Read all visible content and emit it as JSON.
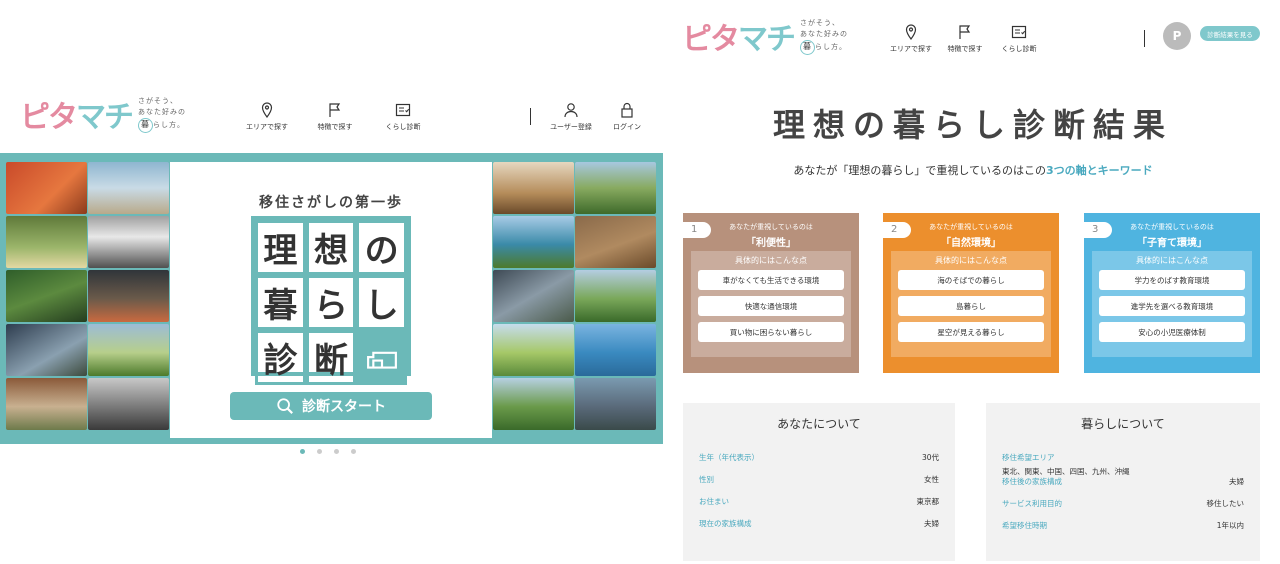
{
  "logo": {
    "text_a": "ピタ",
    "text_b": "マチ",
    "tagline_1": "さがそう、",
    "tagline_2": "あなた好みの",
    "tagline_3a": "暮",
    "tagline_3b": "らし方。"
  },
  "left_nav": [
    {
      "label": "エリアで探す",
      "icon": "map-pin-icon"
    },
    {
      "label": "特徴で探す",
      "icon": "flag-icon"
    },
    {
      "label": "くらし診断",
      "icon": "checklist-icon"
    }
  ],
  "user_nav": [
    {
      "label": "ユーザー登録",
      "icon": "user-icon"
    },
    {
      "label": "ログイン",
      "icon": "lock-icon"
    }
  ],
  "banner": {
    "subtitle": "移住さがしの第一歩",
    "grid": [
      "理",
      "想",
      "の",
      "暮",
      "ら",
      "し",
      "診",
      "断"
    ],
    "start_label": "診断スタート"
  },
  "carousel": {
    "count": 4,
    "active": 1
  },
  "right_nav": [
    {
      "label": "エリアで探す",
      "icon": "map-pin-icon"
    },
    {
      "label": "特徴で探す",
      "icon": "flag-icon"
    },
    {
      "label": "くらし診断",
      "icon": "checklist-icon"
    }
  ],
  "result_button": "診断結果を見る",
  "avatar_letter": "P",
  "result": {
    "title": "理想の暮らし診断結果",
    "desc_a": "あなたが「理想の暮らし」で重視しているのはこの",
    "desc_b": "3つの軸とキーワード"
  },
  "cards": [
    {
      "num": "1",
      "head": "あなたが重視しているのは",
      "key": "「利便性」",
      "label": "具体的にはこんな点",
      "items": [
        "車がなくても生活できる環境",
        "快適な通信環境",
        "買い物に困らない暮らし"
      ],
      "color": "#b7917c"
    },
    {
      "num": "2",
      "head": "あなたが重視しているのは",
      "key": "「自然環境」",
      "label": "具体的にはこんな点",
      "items": [
        "海のそばでの暮らし",
        "島暮らし",
        "星空が見える暮らし"
      ],
      "color": "#ec8f2d"
    },
    {
      "num": "3",
      "head": "あなたが重視しているのは",
      "key": "「子育て環境」",
      "label": "具体的にはこんな点",
      "items": [
        "学力をのばす教育環境",
        "進学先を選べる教育環境",
        "安心の小児医療体制"
      ],
      "color": "#4fb4e0"
    }
  ],
  "about_you": {
    "title": "あなたについて",
    "rows": [
      {
        "k": "生年（年代表示）",
        "v": "30代"
      },
      {
        "k": "性別",
        "v": "女性"
      },
      {
        "k": "お住まい",
        "v": "東京都"
      },
      {
        "k": "現在の家族構成",
        "v": "夫婦"
      }
    ]
  },
  "about_life": {
    "title": "暮らしについて",
    "area_label": "移住希望エリア",
    "area_value": "東北、関東、中国、四国、九州、沖縄",
    "rows": [
      {
        "k": "移住後の家族構成",
        "v": "夫婦"
      },
      {
        "k": "サービス利用目的",
        "v": "移住したい"
      },
      {
        "k": "希望移住時期",
        "v": "1年以内"
      }
    ]
  }
}
